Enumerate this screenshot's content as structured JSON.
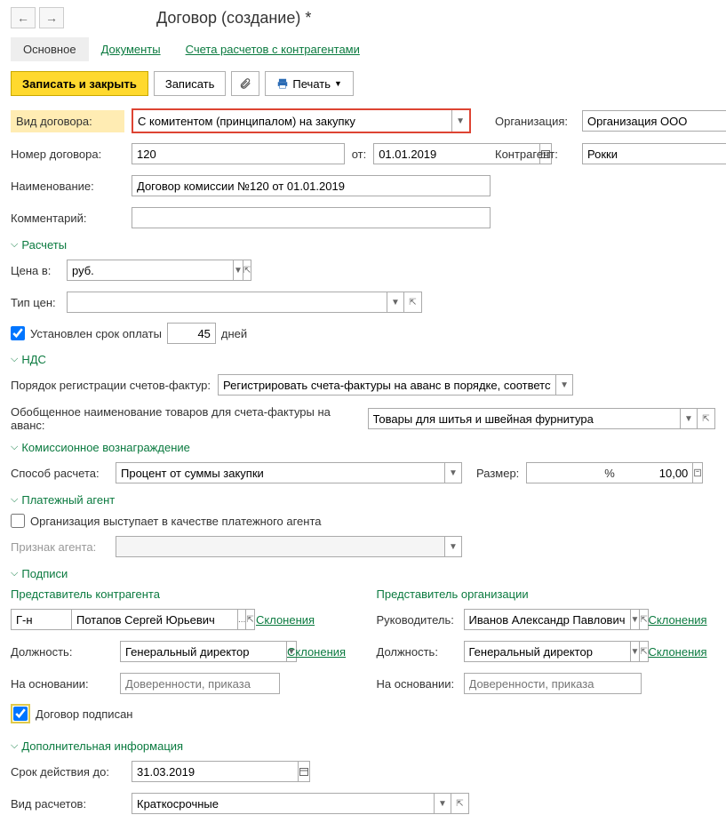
{
  "title": "Договор (создание) *",
  "tabs": {
    "main": "Основное",
    "documents": "Документы",
    "accounts": "Счета расчетов с контрагентами"
  },
  "actions": {
    "save_close": "Записать и закрыть",
    "save": "Записать",
    "print": "Печать"
  },
  "fields": {
    "contract_type_label": "Вид договора:",
    "contract_type_value": "С комитентом (принципалом) на закупку",
    "org_label": "Организация:",
    "org_value": "Организация ООО",
    "number_label": "Номер договора:",
    "number_value": "120",
    "date_label": "от:",
    "date_value": "01.01.2019",
    "counterparty_label": "Контрагент:",
    "counterparty_value": "Рокки",
    "name_label": "Наименование:",
    "name_value": "Договор комиссии №120 от 01.01.2019",
    "comment_label": "Комментарий:",
    "comment_value": ""
  },
  "sections": {
    "payments": "Расчеты",
    "vat": "НДС",
    "commission": "Комиссионное вознаграждение",
    "payment_agent": "Платежный агент",
    "signatures": "Подписи",
    "extra": "Дополнительная информация"
  },
  "payments": {
    "price_in_label": "Цена в:",
    "price_in_value": "руб.",
    "price_type_label": "Тип цен:",
    "price_type_value": "",
    "term_set_label": "Установлен срок оплаты",
    "term_value": "45",
    "term_unit": "дней"
  },
  "vat": {
    "reg_order_label": "Порядок регистрации счетов-фактур:",
    "reg_order_value": "Регистрировать счета-фактуры на аванс в порядке, соответству",
    "goods_name_label": "Обобщенное наименование товаров для счета-фактуры на аванс:",
    "goods_name_value": "Товары для шитья и швейная фурнитура"
  },
  "commission": {
    "method_label": "Способ расчета:",
    "method_value": "Процент от суммы закупки",
    "size_label": "Размер:",
    "size_value": "10,00",
    "size_unit": "%"
  },
  "agent": {
    "is_agent_label": "Организация выступает в качестве платежного агента",
    "sign_label": "Признак агента:",
    "sign_value": ""
  },
  "signatures": {
    "counterparty_rep": "Представитель контрагента",
    "org_rep": "Представитель организации",
    "title_value": "Г-н",
    "cp_name": "Потапов Сергей Юрьевич",
    "declensions": "Склонения",
    "position_label": "Должность:",
    "cp_position": "Генеральный директор",
    "basis_label": "На основании:",
    "basis_placeholder": "Доверенности, приказа",
    "signed_label": "Договор подписан",
    "head_label": "Руководитель:",
    "org_name": "Иванов Александр Павлович",
    "org_position": "Генеральный директор"
  },
  "extra": {
    "valid_until_label": "Срок действия до:",
    "valid_until_value": "31.03.2019",
    "payment_type_label": "Вид расчетов:",
    "payment_type_value": "Краткосрочные"
  }
}
